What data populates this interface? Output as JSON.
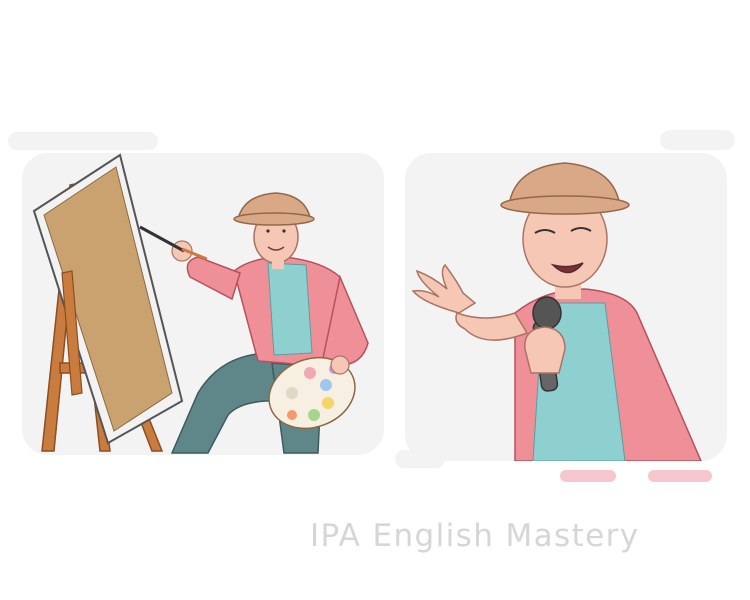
{
  "watermark": {
    "text": "IPA English Mastery"
  },
  "panels": [
    {
      "subject": "artist-painting-at-easel"
    },
    {
      "subject": "man-singing-into-microphone"
    }
  ],
  "colors": {
    "panel_bg": "#f3f3f3",
    "shirt": "#ef8f97",
    "tshirt": "#8ecfd0",
    "skin": "#f5c7b4",
    "hat": "#d9a887",
    "easel": "#c97c3d",
    "canvas": "#c9a26f",
    "pants": "#5f8789",
    "watermark": "#d6d6d6"
  }
}
